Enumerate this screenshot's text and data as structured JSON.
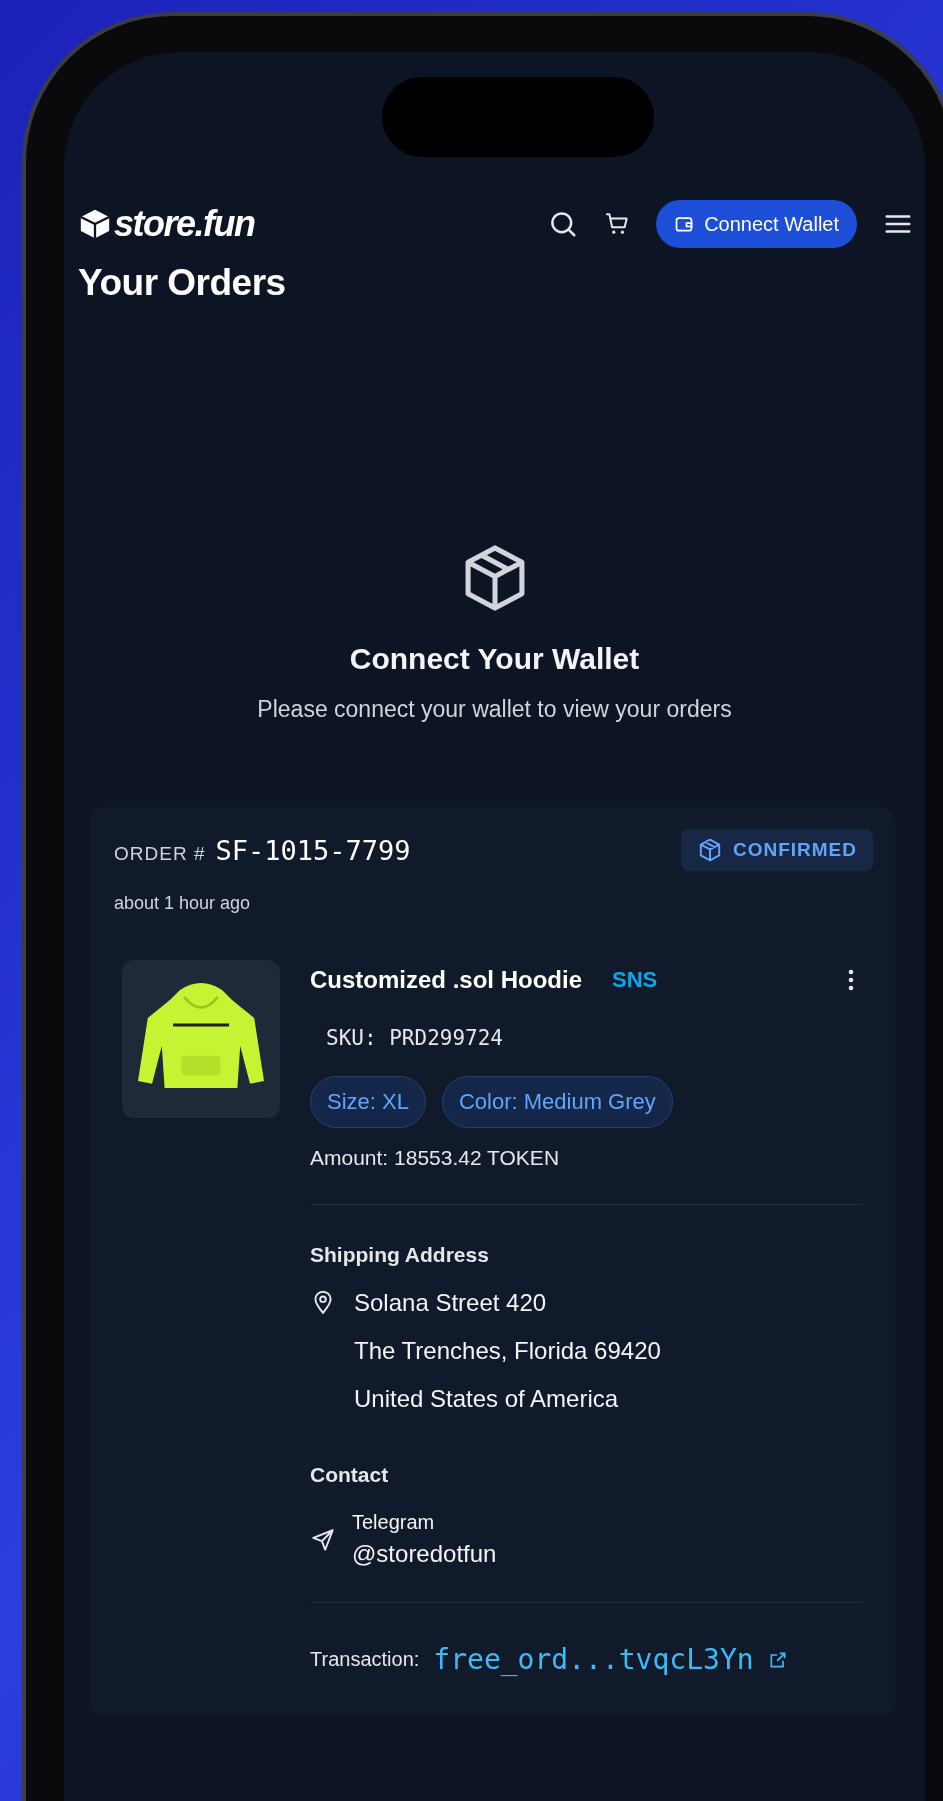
{
  "header": {
    "logo": "store.fun",
    "connect_button": "Connect Wallet"
  },
  "page_title": "Your Orders",
  "empty_state": {
    "title": "Connect Your Wallet",
    "message": "Please connect your wallet to view your orders"
  },
  "order": {
    "label": "ORDER #",
    "number": "SF-1015-7799",
    "status": "CONFIRMED",
    "time": "about 1 hour ago",
    "item": {
      "name": "Customized .sol Hoodie",
      "brand": "SNS",
      "sku": "SKU: PRD299724",
      "tags": [
        "Size: XL",
        "Color: Medium Grey"
      ],
      "amount": "Amount: 18553.42 TOKEN"
    },
    "shipping": {
      "heading": "Shipping Address",
      "lines": [
        "Solana Street 420",
        "The Trenches, Florida 69420",
        "United States of America"
      ]
    },
    "contact": {
      "heading": "Contact",
      "channel": "Telegram",
      "handle": "@storedotfun"
    },
    "transaction": {
      "label": "Transaction:",
      "value": "free_ord...tvqcL3Yn"
    }
  }
}
